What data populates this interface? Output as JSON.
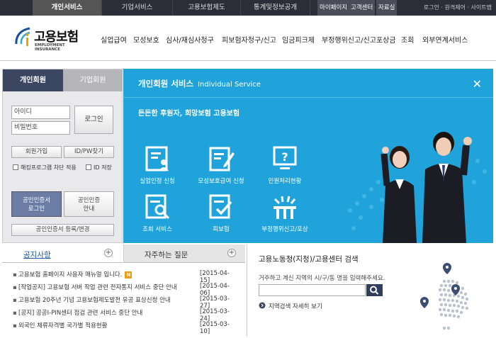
{
  "top_nav": {
    "tabs": [
      "개인서비스",
      "기업서비스",
      "고용보험제도",
      "통계및정보공개"
    ],
    "util_buttons": [
      "마이페이지",
      "고객센터",
      "자료실"
    ],
    "util_links": "로그인 · 원격제어 · 사이트맵"
  },
  "header": {
    "logo_title": "고용보험",
    "logo_sub": "EMPLOYMENT INSURANCE",
    "menu": [
      "실업급여",
      "모성보호",
      "심사/재심사청구",
      "피보험자청구/신고",
      "임금피크제",
      "부정행위신고/신고포상금",
      "조회",
      "외부연계서비스"
    ]
  },
  "login": {
    "tab_personal": "개인회원",
    "tab_corporate": "기업회원",
    "id_placeholder": "아이디",
    "pw_placeholder": "비밀번호",
    "login_button": "로그인",
    "join_button": "회원가입",
    "find_button": "ID/PW찾기",
    "hack_block": "해킹프로그램 차단 적용",
    "save_id": "ID 저장",
    "cert_login": [
      "공인인증서",
      "로그인"
    ],
    "cert_guide": [
      "공인인증",
      "안내"
    ],
    "cert_register": "공인인증서 등록/변경"
  },
  "service": {
    "title": "개인회원 서비스",
    "title_en": "Individual Service",
    "slogan": "든든한 후원자, 희망보험 고용보험",
    "items": [
      "실업인정 신청",
      "모성보호급여 신청",
      "민원처리현황",
      "조회 서비스",
      "피보험",
      "부정행위신고/포상"
    ]
  },
  "notice": {
    "tab_notice": "공지사항",
    "tab_faq": "자주하는 질문",
    "rows": [
      {
        "title": "고용보험 홈페이지 사용자 매뉴얼 입니다.",
        "date": "[2015-04-15]",
        "new": "N"
      },
      {
        "title": "[작업공지] 고용보험 서버 작업 관련 전자통지 서비스 중단 안내",
        "date": "[2015-04-06]"
      },
      {
        "title": "고용보험 20주년 기념 고용보험제도발전 유공 표상신청 안내",
        "date": "[2015-03-27]"
      },
      {
        "title": "[공지] 공공I-PIN센터 점검 관련 서비스 중단 안내",
        "date": "[2015-03-24]"
      },
      {
        "title": "외국인 체류자격별 국가별 적용현황",
        "date": "[2015-03-10]"
      }
    ]
  },
  "search": {
    "title": "고용노동청(지청)/고용센터 검색",
    "desc": "거주하고 계신 지역의 시/구/동 명을 입력해주세요.",
    "link": "지역검색 자세히 보기"
  },
  "colors": {
    "accent_blue": "#1fa3da",
    "navy": "#3b4660",
    "topbar": "#2d2d3a"
  }
}
